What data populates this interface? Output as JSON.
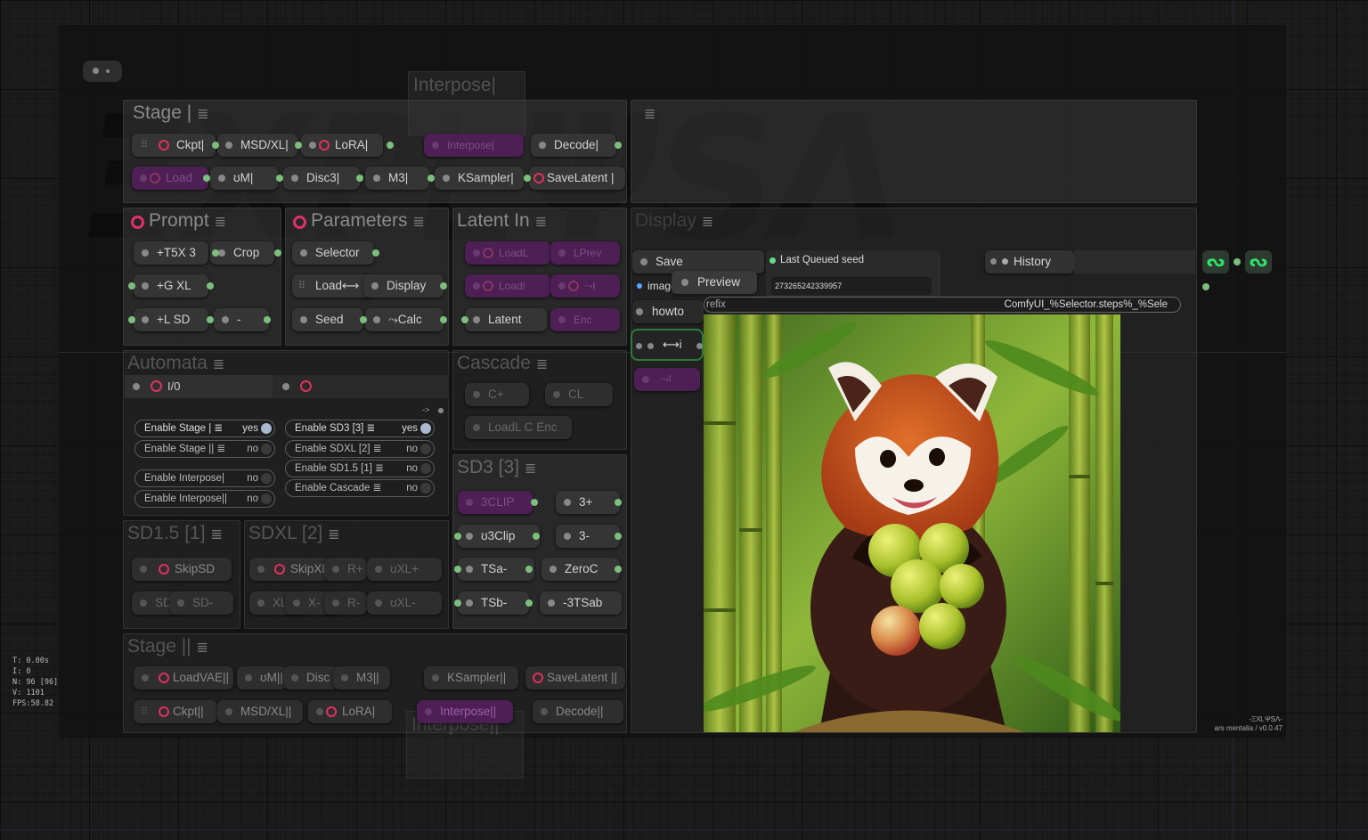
{
  "watermark": {
    "brand": "ΞXPᏞΨSΛ",
    "small": "Interpose|",
    "small_bottom": "Interpose||"
  },
  "groups": {
    "stage1": {
      "title": "Stage |"
    },
    "prompt": {
      "title": "Prompt"
    },
    "parameters": {
      "title": "Parameters"
    },
    "latent_in": {
      "title": "Latent In"
    },
    "automata": {
      "title": "Automata"
    },
    "cascade": {
      "title": "Cascade"
    },
    "sd3": {
      "title": "SD3 [3]"
    },
    "sd15": {
      "title": "SD1.5 [1]"
    },
    "sdxl": {
      "title": "SDXL [2]"
    },
    "stage2": {
      "title": "Stage ||"
    },
    "display": {
      "title": "Display"
    },
    "group_icon": "≣"
  },
  "nodes": {
    "stage1_row1": [
      "Ckpt|",
      "MSD/XL|",
      "LoRA|",
      "Interpose|",
      "Decode|"
    ],
    "stage1_row2": [
      "Load",
      "ʊM|",
      "Disc3|",
      "M3|",
      "KSampler|",
      "SaveLatent |"
    ],
    "prompt": [
      "+T5X 3",
      "Crop",
      "+G XL",
      "+L SD",
      "-"
    ],
    "parameters": [
      "Selector",
      "Load⟷",
      "Display",
      "Seed",
      "⤳Calc"
    ],
    "latent_in": [
      "LoadL",
      "LPrev",
      "Loadl",
      "⤳l",
      "Latent",
      "Enc"
    ],
    "automata_io": "I/0",
    "cascade": [
      "C+",
      "CL",
      "LoadL C Enc"
    ],
    "sd3": [
      "3CLIP",
      "3+",
      "ʊ3Clip",
      "3-",
      "TSa-",
      "ZeroC",
      "TSb-",
      "-3TSab"
    ],
    "sd15": [
      "SkipSD",
      "SD+",
      "SD-"
    ],
    "sdxl": [
      "SkipXL",
      "R+",
      "ʊXL+",
      "XL+",
      "X-",
      "R-",
      "ʊXL-"
    ],
    "stage2_row1": [
      "LoadVAE||",
      "ʊM||",
      "Disc",
      "M3||",
      "KSampler||",
      "SaveLatent ||"
    ],
    "stage2_row2": [
      "Ckpt||",
      "MSD/XL||",
      "LoRA|",
      "Interpose||",
      "Decode||"
    ]
  },
  "toggles": [
    {
      "label": "Enable  Stage | ≣",
      "value": "yes",
      "on": true
    },
    {
      "label": "Enable Stage || ≣",
      "value": "no",
      "on": false
    },
    {
      "label": "Enable Interpose|",
      "value": "no",
      "on": false
    },
    {
      "label": "Enable Interpose||",
      "value": "no",
      "on": false
    },
    {
      "label": "Enable SD3 [3] ≣",
      "value": "yes",
      "on": true
    },
    {
      "label": "Enable SDXL [2] ≣",
      "value": "no",
      "on": false
    },
    {
      "label": "Enable SD1.5 [1] ≣",
      "value": "no",
      "on": false
    },
    {
      "label": "Enable Cascade ≣",
      "value": "no",
      "on": false
    }
  ],
  "arrow_label": "->",
  "display_panel": {
    "save_label": "Save",
    "history_label": "History",
    "last_seed_label": "Last Queued seed",
    "seed_value": "273265242339957",
    "image_label": "image",
    "preview_label": "Preview",
    "howto_label": "howto",
    "io_label": "⟷i",
    "io2_label": "⤳l",
    "prefix_label": "refix",
    "prefix_value": "ComfyUI_%Selector.steps%_%Sele",
    "image_alt": "red panda holding green apples in bamboo forest"
  },
  "stats": "T: 0.00s\nI: 0\nN: 96 [96]\nV: 1101\nFPS:58.82",
  "footer": {
    "brand": "-ΞXᏞΨSΛ-",
    "version": "ars mentalia / v0.0.47"
  },
  "colors": {
    "accent_green": "#2fe06a",
    "ring_red": "#e0306a",
    "purple_node": "#4d1f55"
  }
}
